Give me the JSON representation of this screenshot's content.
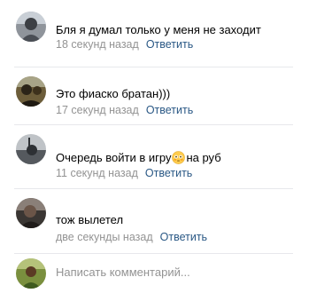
{
  "comments": [
    {
      "text": "Бля я думал только у меня не заходит",
      "time": "18 секунд назад",
      "reply": "Ответить",
      "avatar_icon": "user-photo"
    },
    {
      "text": "Это фиаско братан)))",
      "time": "17 секунд назад",
      "reply": "Ответить",
      "avatar_icon": "user-photo"
    },
    {
      "text_before": "Очередь войти в игру",
      "text_after": "на руб",
      "emoji_icon": "flushed-face-emoji",
      "time": "11 секунд назад",
      "reply": "Ответить",
      "avatar_icon": "user-photo"
    },
    {
      "text": "тож вылетел",
      "time": "две секунды назад",
      "reply": "Ответить",
      "avatar_icon": "user-photo"
    }
  ],
  "composer": {
    "placeholder": "Написать комментарий..."
  },
  "colors": {
    "link": "#2a5885",
    "meta": "#939393",
    "divider": "#e7e8ec"
  }
}
